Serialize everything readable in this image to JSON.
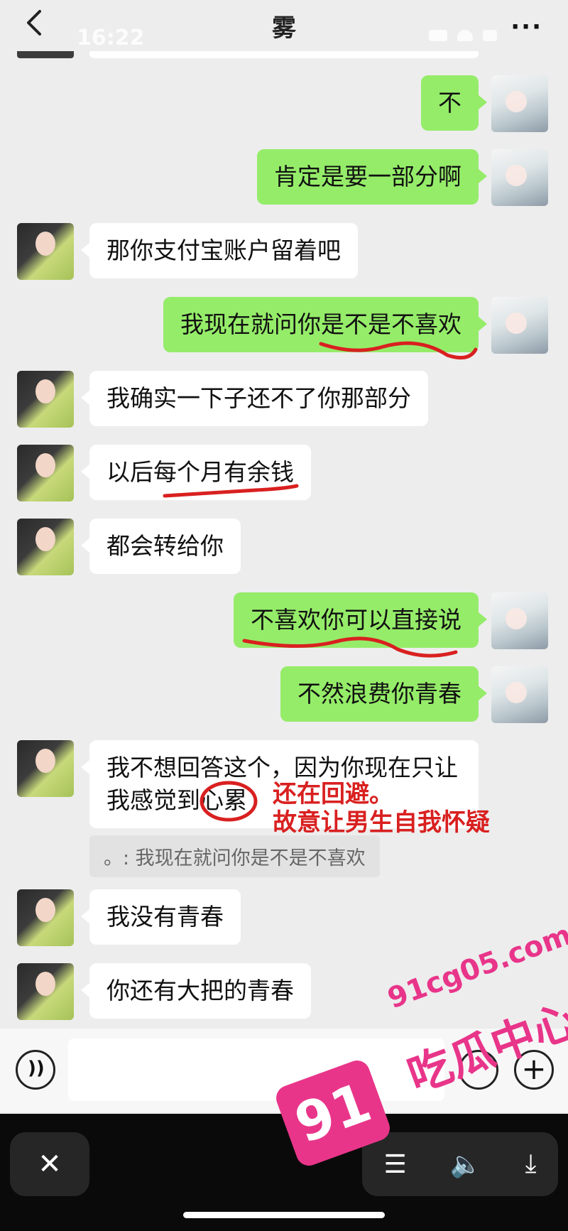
{
  "header": {
    "time": "16:22",
    "title": "雾",
    "more": "···"
  },
  "messages": [
    {
      "side": "right",
      "text": "不"
    },
    {
      "side": "right",
      "text": "肯定是要一部分啊"
    },
    {
      "side": "left",
      "text": "那你支付宝账户留着吧"
    },
    {
      "side": "right",
      "text": "我现在就问你是不是不喜欢"
    },
    {
      "side": "left",
      "text": "我确实一下子还不了你那部分"
    },
    {
      "side": "left",
      "text": "以后每个月有余钱"
    },
    {
      "side": "left",
      "text": "都会转给你"
    },
    {
      "side": "right",
      "text": "不喜欢你可以直接说"
    },
    {
      "side": "right",
      "text": "不然浪费你青春"
    },
    {
      "side": "left",
      "text": "我不想回答这个，因为你现在只让我感觉到心累"
    },
    {
      "side": "left",
      "text": "我没有青春"
    },
    {
      "side": "left",
      "text": "你还有大把的青春"
    }
  ],
  "quote": "。: 我现在就问你是不是不喜欢",
  "annotation": {
    "line1": "还在回避。",
    "line2": "故意让男生自我怀疑"
  },
  "toolbar": {
    "close": "✕",
    "menu": "☰",
    "sound": "🔈",
    "download": "⤓"
  },
  "watermark": {
    "badge": "91",
    "url": "91cg05.com",
    "name": "吃瓜中心"
  },
  "colors": {
    "background": "#ededed",
    "bubble_self": "#95ec69",
    "bubble_other": "#ffffff",
    "annotation": "#d92020",
    "watermark": "#e8358a"
  },
  "icons": [
    "back-icon",
    "more-icon",
    "voice-icon",
    "emoji-icon",
    "plus-icon",
    "close-icon",
    "menu-icon",
    "speaker-icon",
    "download-icon"
  ]
}
